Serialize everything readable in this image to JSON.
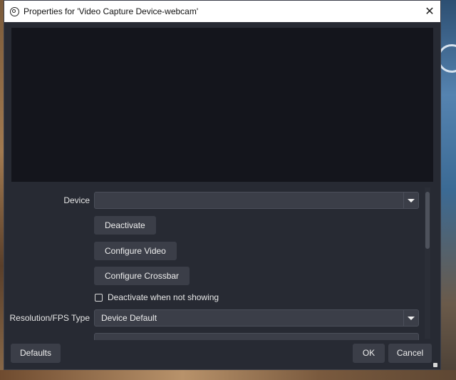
{
  "window": {
    "title": "Properties for 'Video Capture Device-webcam'"
  },
  "form": {
    "device_label": "Device",
    "device_value": "",
    "deactivate_label": "Deactivate",
    "configure_video_label": "Configure Video",
    "configure_crossbar_label": "Configure Crossbar",
    "deactivate_when_not_showing_label": "Deactivate when not showing",
    "deactivate_when_not_showing_checked": false,
    "resolution_label": "Resolution/FPS Type",
    "resolution_value": "Device Default"
  },
  "footer": {
    "defaults_label": "Defaults",
    "ok_label": "OK",
    "cancel_label": "Cancel"
  },
  "colors": {
    "dialog_bg": "#272a33",
    "preview_bg": "#14151c",
    "control_bg": "#3b3e48",
    "titlebar_bg": "#ffffff"
  },
  "icons": {
    "app": "obs-icon",
    "close": "close-icon",
    "dropdown": "chevron-down-icon"
  }
}
